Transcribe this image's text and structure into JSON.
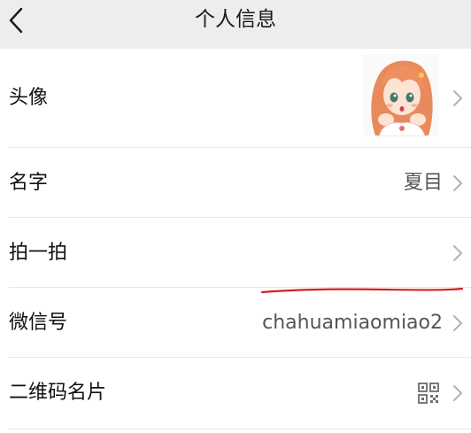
{
  "header": {
    "title": "个人信息"
  },
  "rows": [
    {
      "label": "头像"
    },
    {
      "label": "名字",
      "value": "夏目"
    },
    {
      "label": "拍一拍"
    },
    {
      "label": "微信号",
      "value": "chahuamiaomiao2"
    },
    {
      "label": "二维码名片"
    }
  ],
  "icons": {
    "back": "chevron-left-icon",
    "row_arrow": "chevron-right-icon",
    "qr": "qr-code-icon"
  },
  "colors": {
    "header_bg": "#ededed",
    "list_bg": "#ffffff",
    "annotation_red": "#d42020"
  }
}
